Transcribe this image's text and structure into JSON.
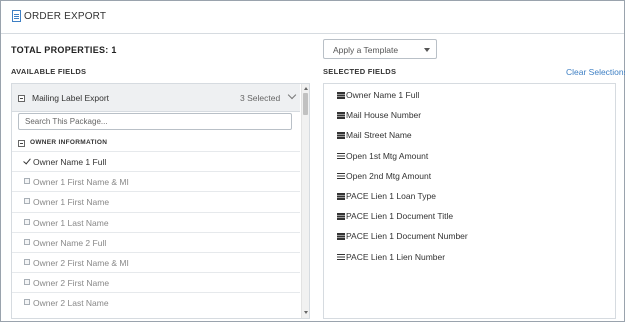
{
  "header": {
    "title": "ORDER EXPORT",
    "icon": "document-icon"
  },
  "summary": {
    "total_properties": "TOTAL PROPERTIES: 1"
  },
  "template_select": {
    "value": "Apply a Template"
  },
  "available": {
    "label": "AVAILABLE FIELDS",
    "package": {
      "name": "Mailing Label Export",
      "count": "3 Selected"
    },
    "search": {
      "placeholder": "Search This Package..."
    },
    "group": {
      "name": "OWNER INFORMATION"
    },
    "fields": [
      {
        "label": "Owner Name 1 Full",
        "checked": true
      },
      {
        "label": "Owner 1 First Name & MI",
        "checked": false
      },
      {
        "label": "Owner 1 First Name",
        "checked": false
      },
      {
        "label": "Owner 1 Last Name",
        "checked": false
      },
      {
        "label": "Owner Name 2 Full",
        "checked": false
      },
      {
        "label": "Owner 2 First Name & MI",
        "checked": false
      },
      {
        "label": "Owner 2 First Name",
        "checked": false
      },
      {
        "label": "Owner 2 Last Name",
        "checked": false
      }
    ]
  },
  "selected": {
    "label": "SELECTED FIELDS",
    "clear_label": "Clear Selections",
    "items": [
      "Owner Name 1 Full",
      "Mail House Number",
      "Mail Street Name",
      "Open 1st Mtg Amount",
      "Open 2nd Mtg Amount",
      "PACE Lien 1 Loan Type",
      "PACE Lien 1 Document Title",
      "PACE Lien 1 Document Number",
      "PACE Lien 1 Lien Number"
    ]
  },
  "colors": {
    "accent": "#3d7fc4",
    "border": "#d6dbe0",
    "package_bg": "#eef0f2"
  }
}
